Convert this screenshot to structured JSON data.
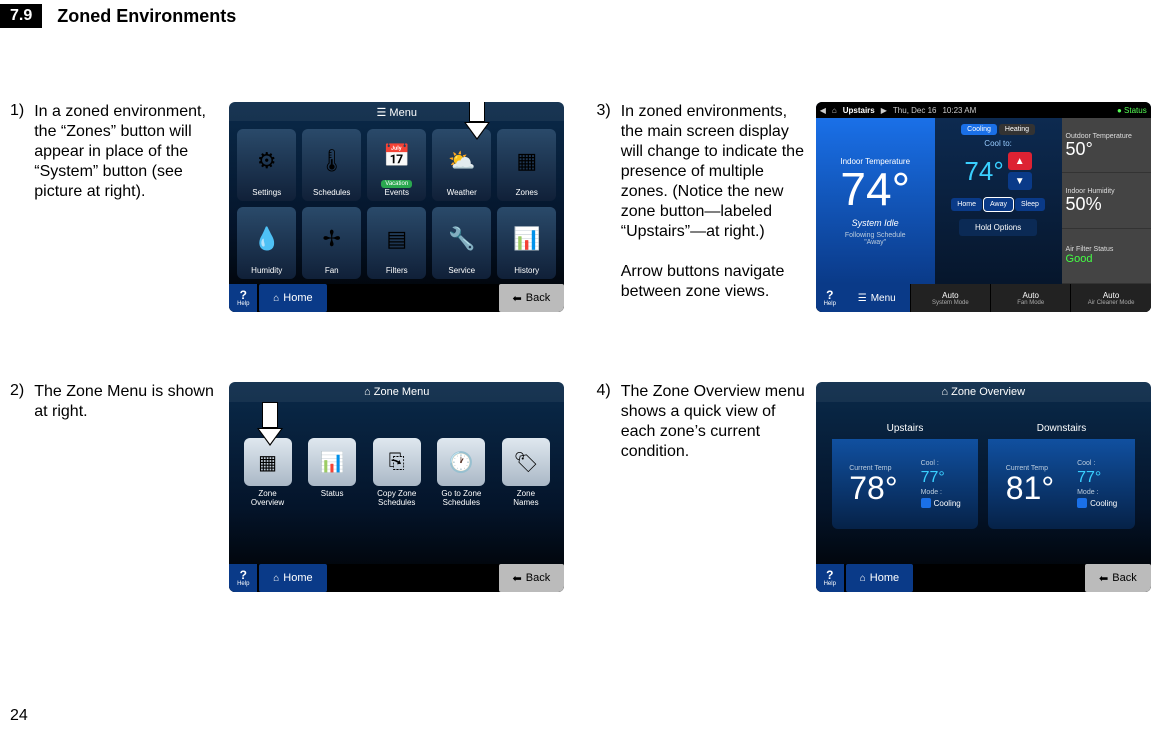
{
  "header": {
    "section_number": "7.9",
    "section_title": "Zoned Environments"
  },
  "page_number": "24",
  "items": {
    "i1": {
      "num": "1)",
      "desc": "In a zoned environment, the “Zones” button will appear in place of the “System” button (see picture at right)."
    },
    "i2": {
      "num": "2)",
      "desc": "The Zone Menu is shown at right."
    },
    "i3": {
      "num": "3)",
      "desc_a": "In zoned environments, the main screen display will change to indicate the presence of multiple zones. (Notice the new zone button—labeled “Upstairs”—at right.)",
      "desc_b": "Arrow buttons navigate between zone views."
    },
    "i4": {
      "num": "4)",
      "desc": "The Zone Overview menu shows a quick view of each zone’s current condition."
    }
  },
  "s1": {
    "title": "Menu",
    "cells": [
      "Settings",
      "Schedules",
      "Events",
      "Weather",
      "Zones",
      "Humidity",
      "Fan",
      "Filters",
      "Service",
      "History"
    ],
    "vacation": "Vacation",
    "help": "Help",
    "home": "Home",
    "back": "Back"
  },
  "s2": {
    "title": "Zone Menu",
    "cells": [
      "Zone\nOverview",
      "Status",
      "Copy Zone\nSchedules",
      "Go to Zone\nSchedules",
      "Zone\nNames"
    ],
    "help": "Help",
    "home": "Home",
    "back": "Back"
  },
  "s3": {
    "top": {
      "zone": "Upstairs",
      "date": "Thu, Dec 16",
      "time": "10:23 AM",
      "status": "Status"
    },
    "left": {
      "lbl": "Indoor Temperature",
      "temp": "74°",
      "sys": "System Idle",
      "sched": "Following Schedule\n\"Away\""
    },
    "mid": {
      "cool": "Cooling",
      "heat": "Heating",
      "cool_to": "Cool to:",
      "cool_val": "74°",
      "home": "Home",
      "away": "Away",
      "sleep": "Sleep",
      "hold": "Hold Options"
    },
    "right": {
      "otemp_l": "Outdoor Temperature",
      "otemp_v": "50°",
      "ihum_l": "Indoor Humidity",
      "ihum_v": "50%",
      "afs_l": "Air Filter Status",
      "afs_v": "Good"
    },
    "bottom": {
      "help": "Help",
      "menu": "Menu",
      "sm_t": "Auto",
      "sm_s": "System Mode",
      "fm_t": "Auto",
      "fm_s": "Fan Mode",
      "ac_t": "Auto",
      "ac_s": "Air Cleaner Mode"
    }
  },
  "s4": {
    "title": "Zone Overview",
    "cards": [
      {
        "name": "Upstairs",
        "cur_l": "Current Temp",
        "cur_v": "78°",
        "cool_l": "Cool :",
        "cool_v": "77°",
        "mode_l": "Mode :",
        "mode_v": "Cooling"
      },
      {
        "name": "Downstairs",
        "cur_l": "Current Temp",
        "cur_v": "81°",
        "cool_l": "Cool :",
        "cool_v": "77°",
        "mode_l": "Mode :",
        "mode_v": "Cooling"
      }
    ],
    "help": "Help",
    "home": "Home",
    "back": "Back"
  }
}
